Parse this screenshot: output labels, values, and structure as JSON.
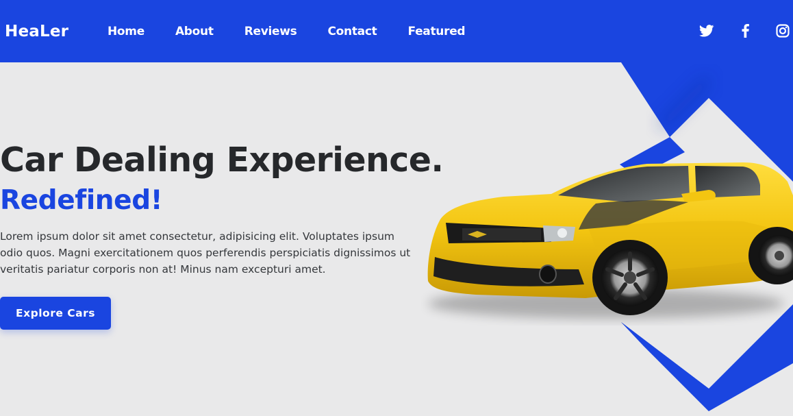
{
  "brand": {
    "name": "HeaLer"
  },
  "nav": {
    "links": [
      "Home",
      "About",
      "Reviews",
      "Contact",
      "Featured"
    ]
  },
  "social": {
    "icons": [
      "twitter-icon",
      "facebook-icon",
      "instagram-icon"
    ]
  },
  "hero": {
    "title": "Car Dealing Experience.",
    "subtitle": "Redefined!",
    "description": "Lorem ipsum dolor sit amet consectetur, adipisicing elit. Voluptates ipsum odio quos. Magni exercitationem quos perferendis perspiciatis dignissimos ut veritatis pariatur corporis non at! Minus nam excepturi amet.",
    "cta_label": "Explore Cars",
    "image": "yellow-sports-car"
  },
  "colors": {
    "accent": "#1a45e0",
    "background": "#e9e9ea",
    "heading": "#26282b",
    "text": "#34373b",
    "car_body": "#f3c511"
  }
}
